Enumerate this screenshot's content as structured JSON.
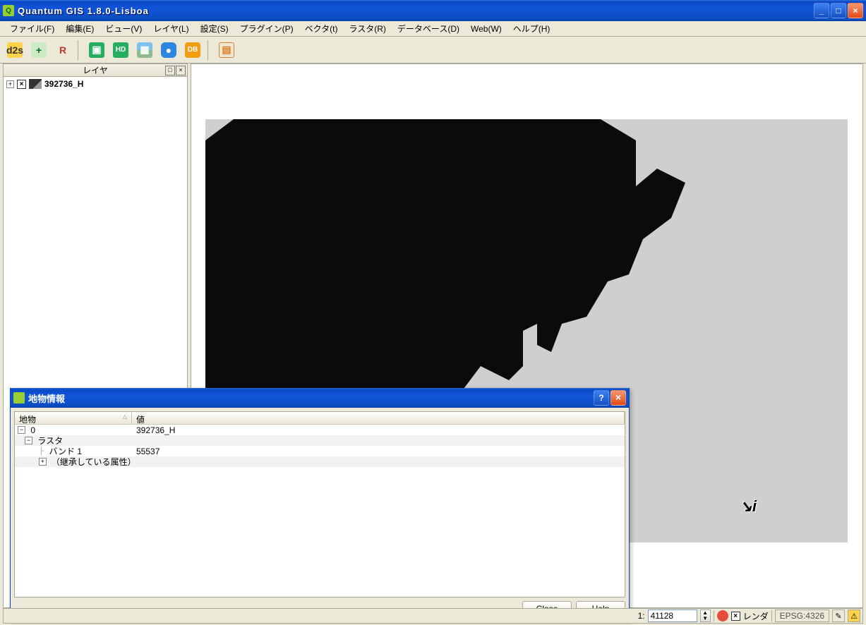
{
  "app": {
    "title": "Quantum GIS 1.8.0-Lisboa"
  },
  "menu": {
    "file": "ファイル(F)",
    "edit": "編集(E)",
    "view": "ビュー(V)",
    "layer": "レイヤ(L)",
    "settings": "設定(S)",
    "plugin": "プラグイン(P)",
    "vector": "ベクタ(t)",
    "raster": "ラスタ(R)",
    "database": "データベース(D)",
    "web": "Web(W)",
    "help": "ヘルプ(H)"
  },
  "toolbar": {
    "btn1": "d2s",
    "btn_addvector": "+",
    "btn_addraster": "R",
    "btn_green1": "▣",
    "btn_green2": "HD",
    "btn_landscape": "▦",
    "btn_wms": "●",
    "btn_db": "DB",
    "btn_sep_img": "▤"
  },
  "layers": {
    "panel_title": "レイヤ",
    "items": [
      {
        "expand": "+",
        "checked": "×",
        "name": "392736_H"
      }
    ]
  },
  "identify_dialog": {
    "title": "地物情報",
    "col1": "地物",
    "col2": "値",
    "rows": [
      {
        "indent": 0,
        "expand": "−",
        "label": "0",
        "value": "392736_H"
      },
      {
        "indent": 1,
        "expand": "−",
        "label": "ラスタ",
        "value": ""
      },
      {
        "indent": 2,
        "expand": "",
        "label": "バンド 1",
        "value": "55537"
      },
      {
        "indent": 2,
        "expand": "+",
        "label": "（継承している属性）",
        "value": ""
      }
    ],
    "close_btn": "Close",
    "help_btn": "Help"
  },
  "statusbar": {
    "scale_prefix": "1:",
    "scale_value": "41128",
    "render_checked": "×",
    "render_label": "レンダ",
    "epsg": "EPSG:4326",
    "log_icon": "✎",
    "warn_icon": "⚠"
  }
}
